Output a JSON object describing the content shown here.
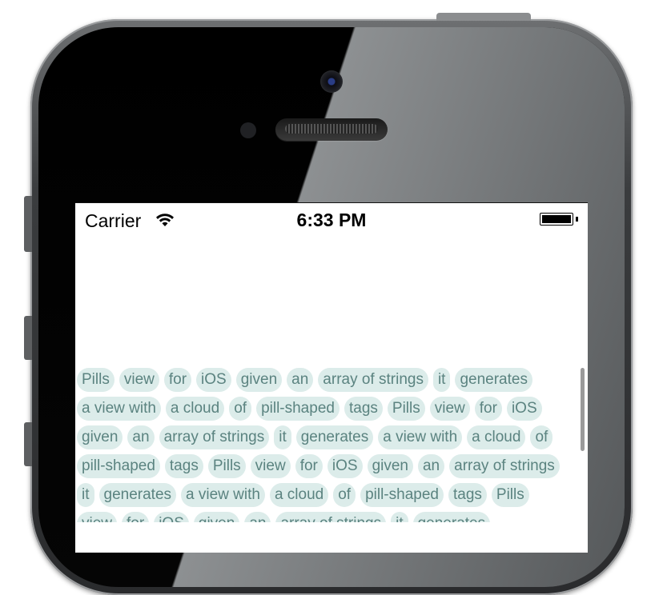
{
  "status_bar": {
    "carrier": "Carrier",
    "time": "6:33 PM"
  },
  "pill_rows": [
    [
      "Pills",
      "view",
      "for",
      "iOS",
      "given",
      "an",
      "array of strings",
      "it",
      "generates"
    ],
    [
      "a view with",
      "a cloud",
      "of",
      "pill-shaped",
      "tags",
      "Pills",
      "view",
      "for",
      "iOS"
    ],
    [
      "given",
      "an",
      "array of strings",
      "it",
      "generates",
      "a view with",
      "a cloud",
      "of"
    ],
    [
      "pill-shaped",
      "tags",
      "Pills",
      "view",
      "for",
      "iOS",
      "given",
      "an",
      "array of strings"
    ],
    [
      "it",
      "generates",
      "a view with",
      "a cloud",
      "of",
      "pill-shaped",
      "tags",
      "Pills"
    ],
    [
      "view",
      "for",
      "iOS",
      "given",
      "an",
      "array of strings",
      "it",
      "generates"
    ]
  ],
  "colors": {
    "pill_background": "#dcecea",
    "pill_text": "#5b8380"
  },
  "icons": [
    "wifi-icon",
    "battery-icon"
  ]
}
